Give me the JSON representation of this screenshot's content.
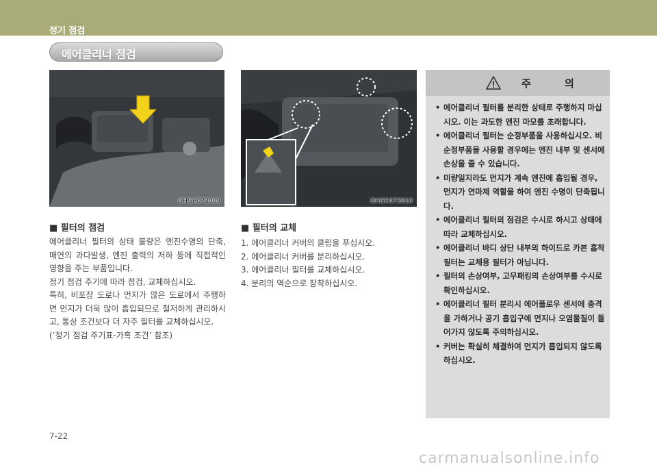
{
  "header": {
    "chapter_title": "정기 점검"
  },
  "section": {
    "title": "에어클리너 점검"
  },
  "figures": [
    {
      "code": "OHGH073009"
    },
    {
      "code": "OHGH073010"
    }
  ],
  "inspection": {
    "heading": "■ 필터의 점검",
    "paragraphs": [
      "에어클리너 필터의 상태 불량은 엔진수명의 단축, 매연의 과다발생, 엔진 출력의 저하 등에 직접적인 영향을 주는 부품입니다.",
      "정기 점검 주기에 따라 점검, 교체하십시오.",
      "특히, 비포장 도로나 먼지가 많은 도로에서 주행하면 먼지가 더욱 많이 흡입되므로 철저하게 관리하시고, 통상 조건보다 더 자주 필터를 교체하십시오.",
      "(‘정기 점검 주기표-가혹 조건’ 참조)"
    ]
  },
  "replacement": {
    "heading": "■ 필터의 교체",
    "steps": [
      "1.  에어클리너 커버의 클립을 푸십시오.",
      "2.  에어클리너 커버를 분리하십시오.",
      "3.  에어클리너 필터를 교체하십시오.",
      "4.  분리의 역순으로 장착하십시오."
    ]
  },
  "caution": {
    "title": "주 의",
    "items": [
      "에어클리너 필터를 분리한 상태로 주행하지 마십시오. 이는 과도한 엔진 마모를 초래합니다.",
      "에어클리너 필터는 순정부품을 사용하십시오. 비순정부품을 사용할 경우에는 엔진 내부 및 센서에 손상을 줄 수 있습니다.",
      "미량일지라도 먼지가 계속 엔진에 흡입될 경우, 먼지가 연마제 역할을 하여 엔진 수명이 단축됩니다.",
      "에어클리너 필터의 점검은 수시로 하시고 상태에 따라 교체하십시오.",
      "에어클리너 바디 상단 내부의 하이드로 카본 흡착필터는 교체용 필터가 아닙니다.",
      "필터의 손상여부, 고무패킹의 손상여부를 수시로 확인하십시오.",
      "에어클리너 필터 분리시 에어플로우 센서에 충격을 가하거나 공기 흡입구에 먼지나 오염물질이 들어가지 않도록 주의하십시오.",
      "커버는 확실히 체결하여 먼지가 흡입되지 않도록 하십시오."
    ]
  },
  "footer": {
    "page_number": "7-22"
  },
  "watermark": "carmanualsonline.info",
  "colors": {
    "header_band": "#a9ab79",
    "caution_bg": "#dcdcdc",
    "arrow": "#f2d21a"
  }
}
